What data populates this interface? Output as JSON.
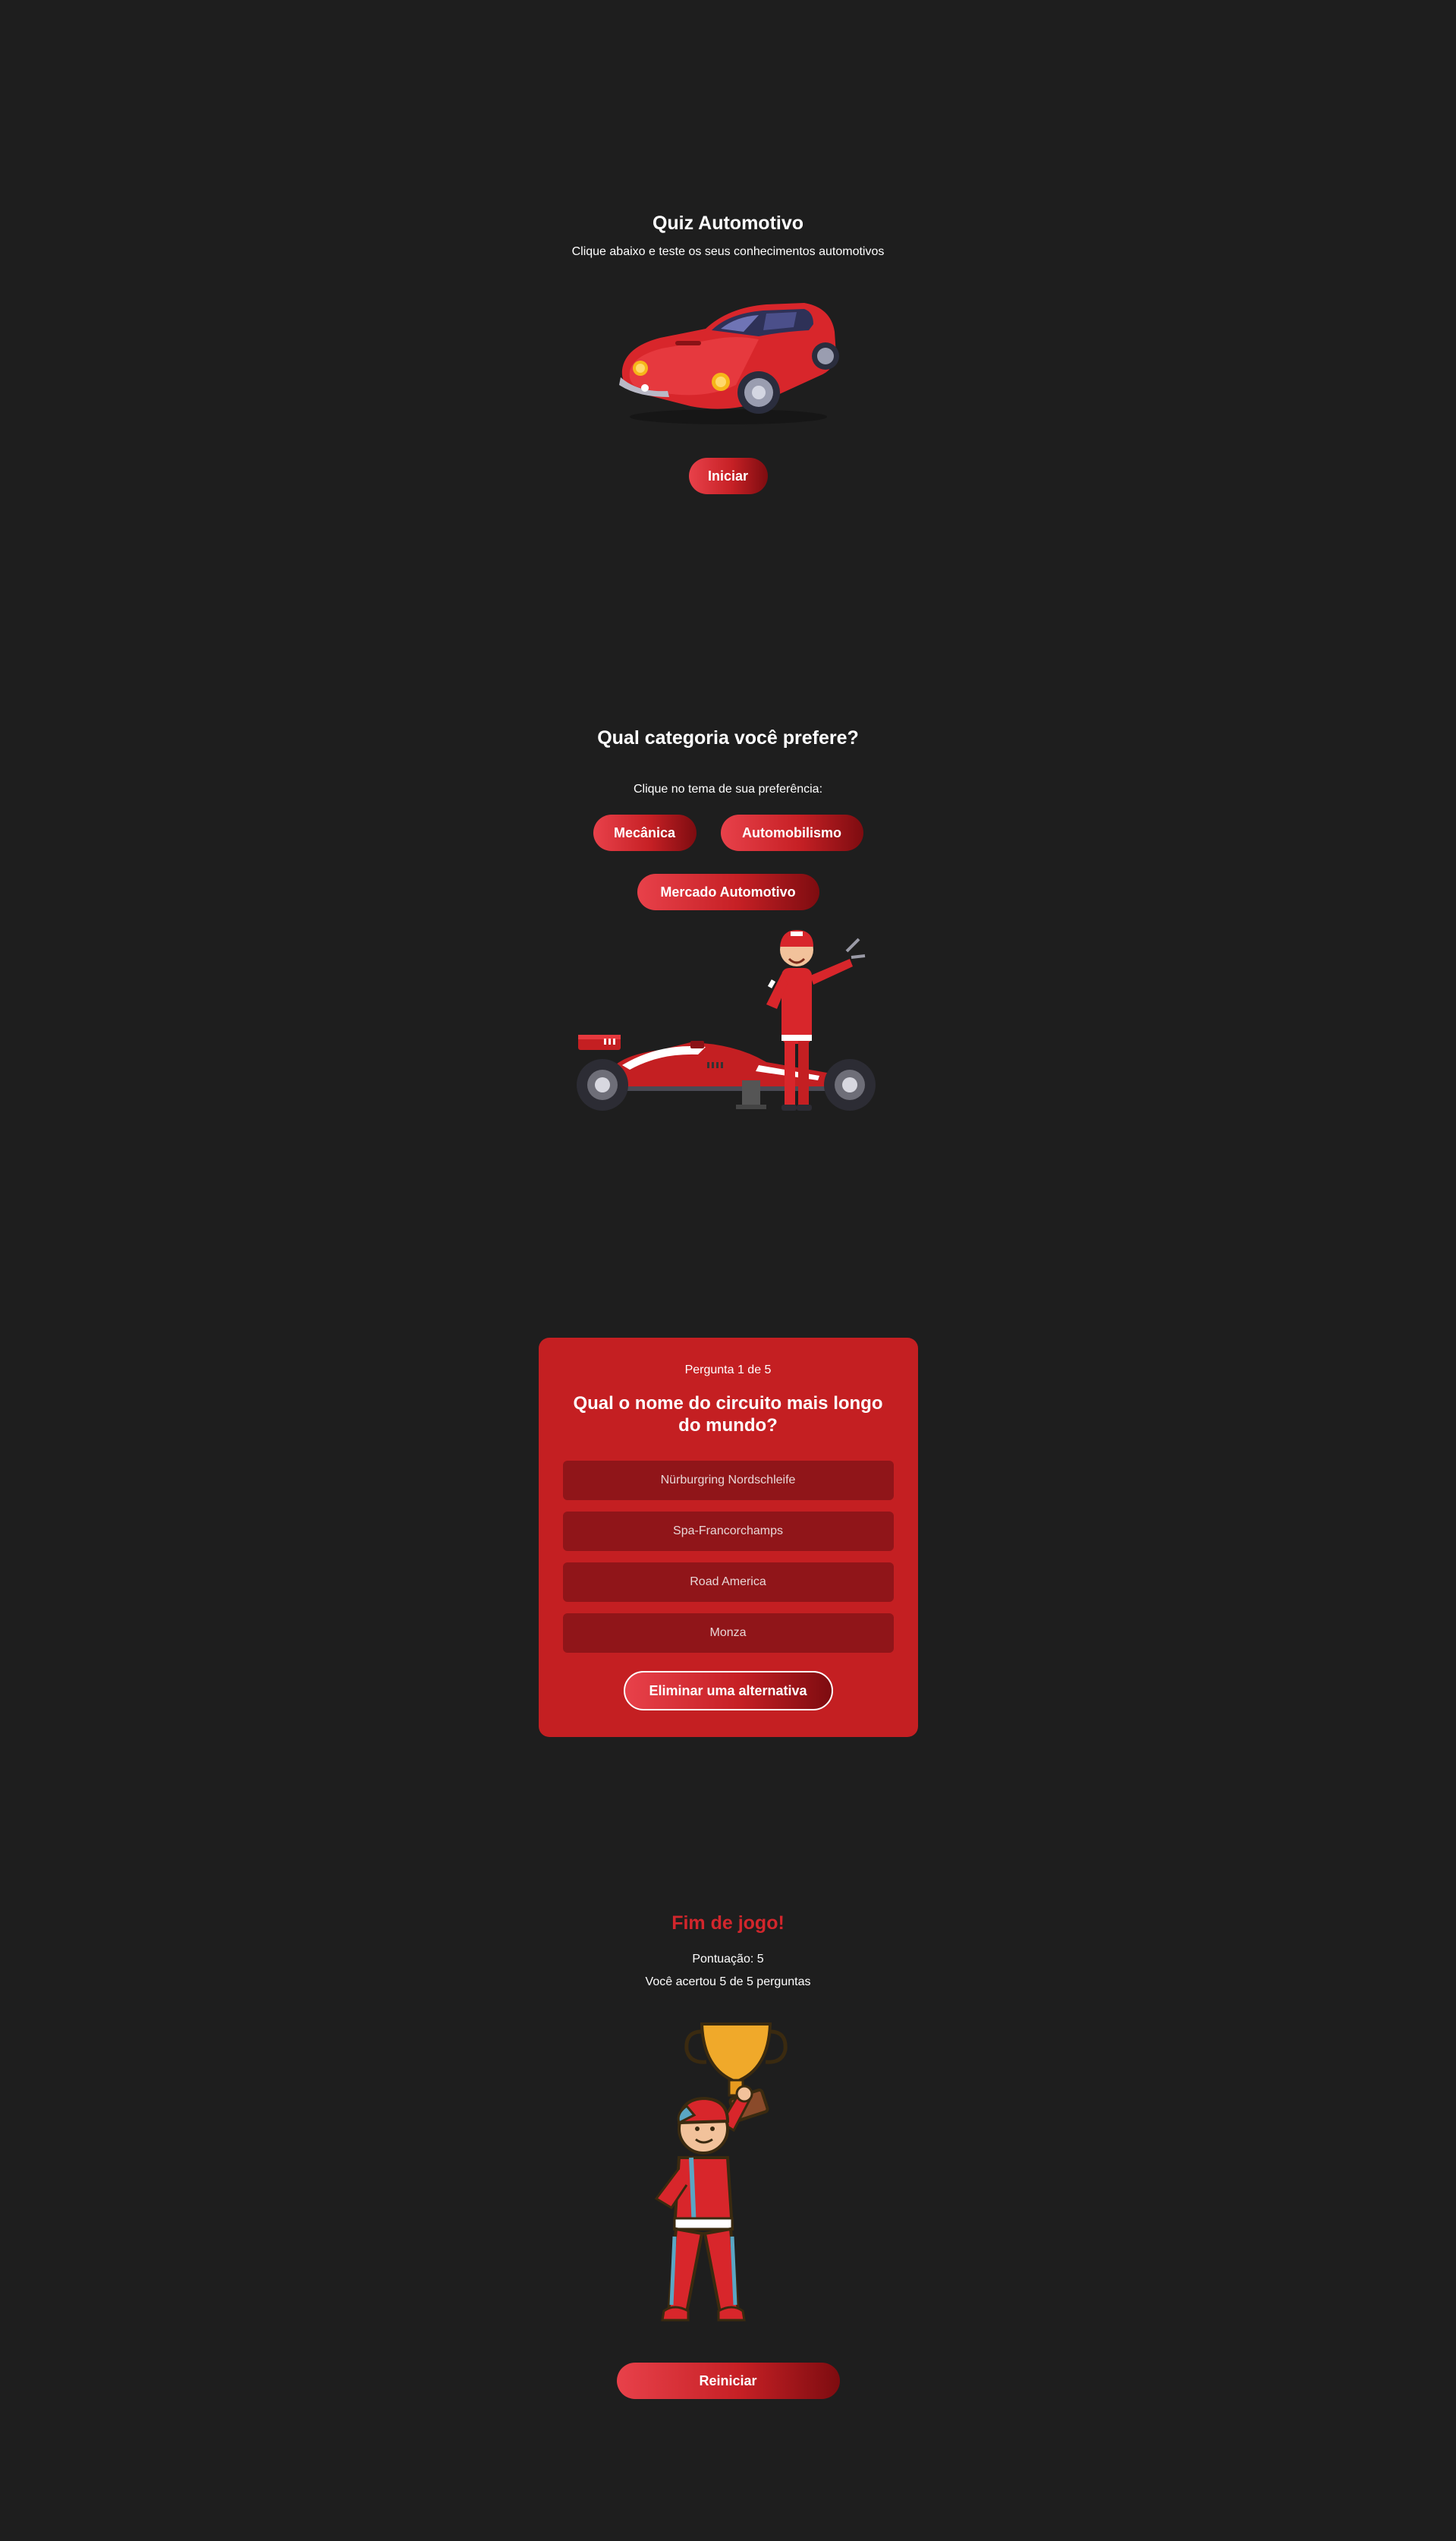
{
  "intro": {
    "title": "Quiz Automotivo",
    "subtitle": "Clique abaixo e teste os seus conhecimentos automotivos",
    "start_label": "Iniciar",
    "illustration": "red-sports-car"
  },
  "category": {
    "title": "Qual categoria você prefere?",
    "subtitle": "Clique no tema de sua preferência:",
    "options": [
      "Mecânica",
      "Automobilismo",
      "Mercado Automotivo"
    ],
    "illustration": "f1-car-with-mechanic"
  },
  "question": {
    "counter": "Pergunta 1 de 5",
    "text": "Qual o nome do circuito mais longo do mundo?",
    "answers": [
      "Nürburgring Nordschleife",
      "Spa-Francorchamps",
      "Road America",
      "Monza"
    ],
    "eliminate_label": "Eliminar uma alternativa"
  },
  "end": {
    "title": "Fim de jogo!",
    "score": "Pontuação: 5",
    "result": "Você acertou 5 de 5 perguntas",
    "restart_label": "Reiniciar",
    "illustration": "racer-holding-trophy"
  },
  "colors": {
    "background": "#1e1e1e",
    "accent": "#c41f22",
    "answer_bg": "#901519",
    "end_title": "#d2262c"
  }
}
